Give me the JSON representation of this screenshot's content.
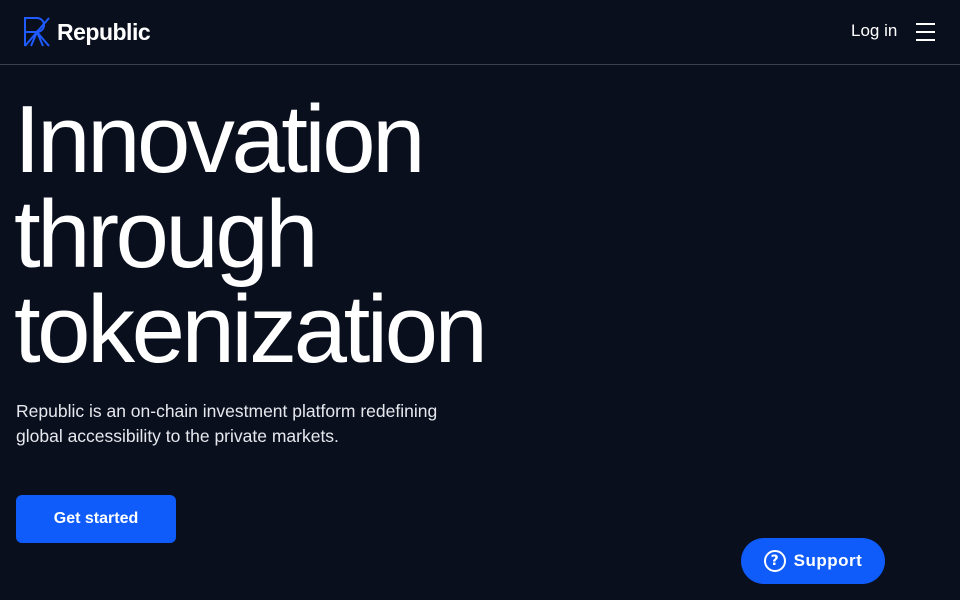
{
  "header": {
    "logo_text": "Republic",
    "login_label": "Log in",
    "menu_icon": "hamburger-menu-icon"
  },
  "hero": {
    "title_lines": [
      "Innovation",
      "through",
      "tokenization"
    ],
    "description": "Republic is an on-chain investment platform redefining global accessibility to the private markets.",
    "cta_label": "Get started"
  },
  "support": {
    "label": "Support",
    "icon": "question-circle-icon",
    "icon_glyph": "?"
  },
  "colors": {
    "background": "#0a0f1e",
    "accent": "#0f5cfb",
    "logo_mark": "#1f5bff",
    "text": "#ffffff",
    "divider": "#3a3f4d"
  }
}
